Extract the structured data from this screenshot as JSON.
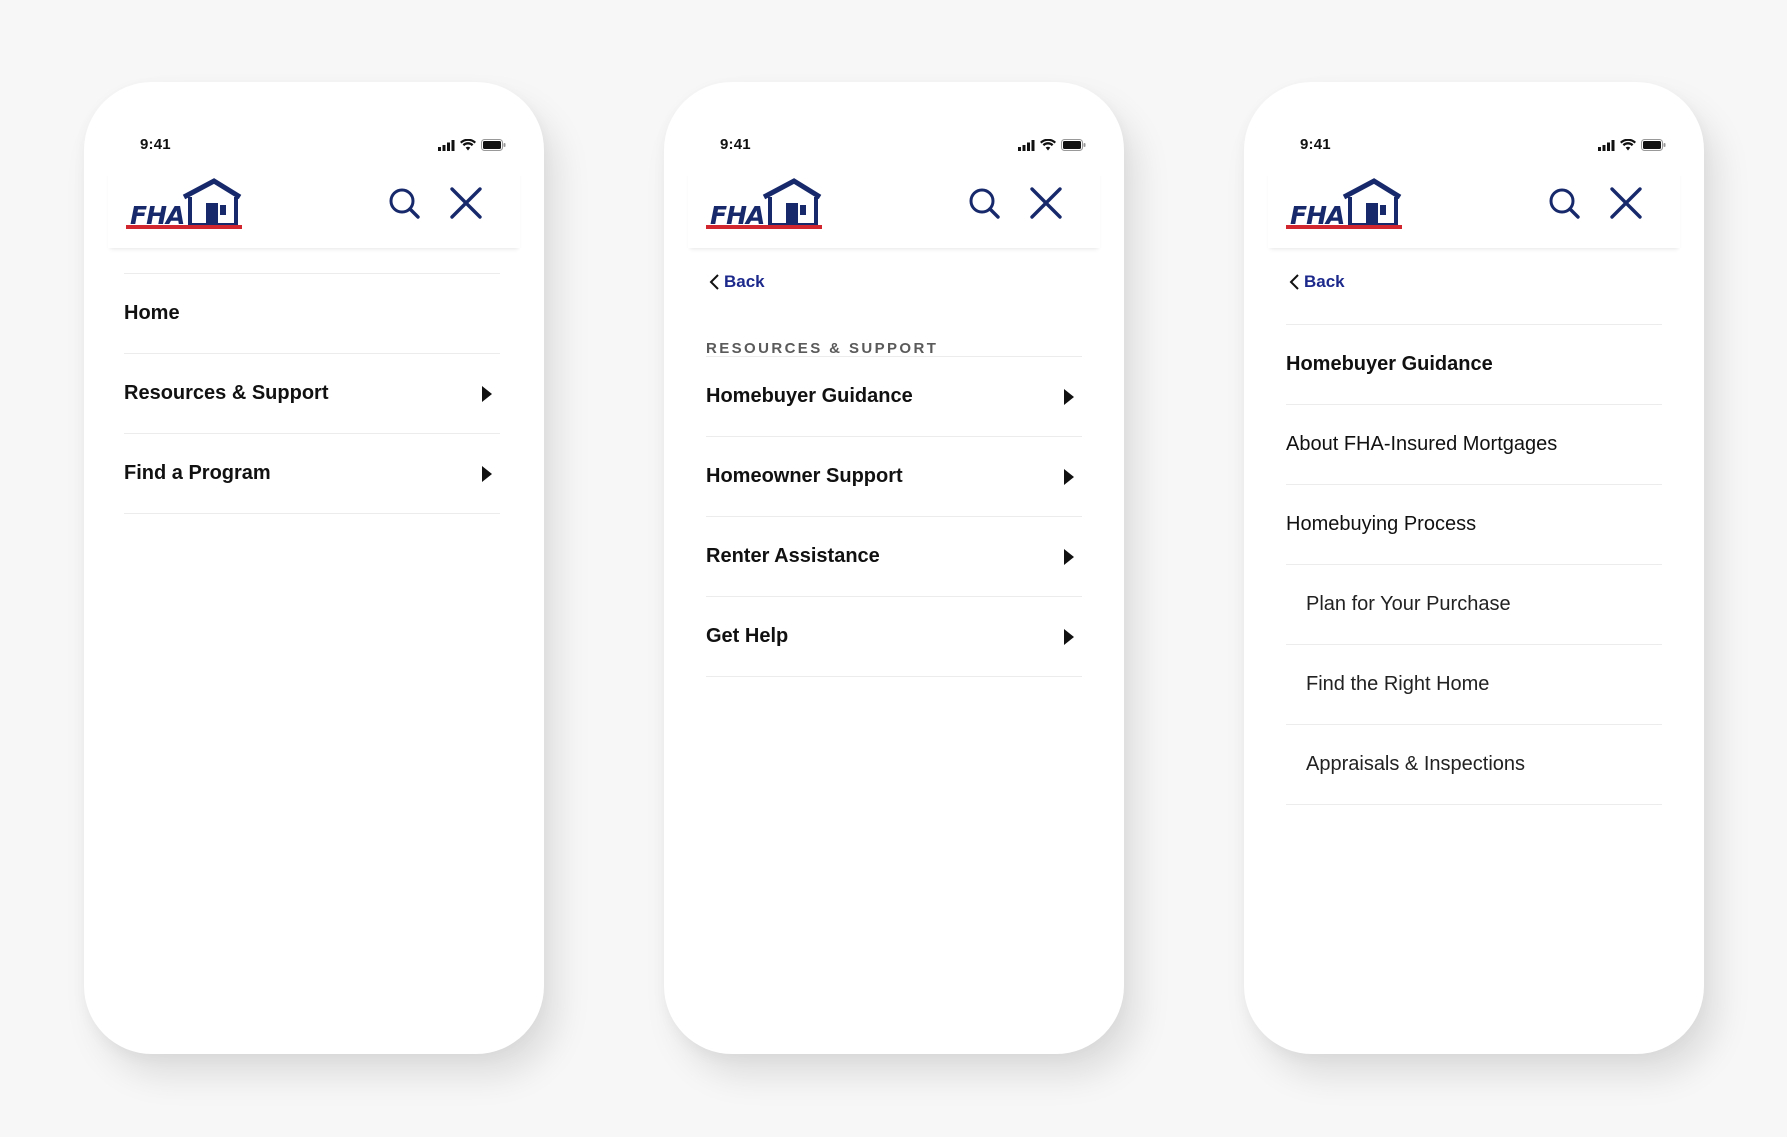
{
  "status": {
    "time": "9:41"
  },
  "logo": {
    "text": "FHA"
  },
  "brand": {
    "navy": "#17296b",
    "red": "#d2262f",
    "link": "#1d2a8c"
  },
  "header": {
    "search_icon": "search-icon",
    "close_icon": "close-icon"
  },
  "screen1": {
    "items": [
      {
        "label": "Home",
        "has_submenu": false
      },
      {
        "label": "Resources & Support",
        "has_submenu": true
      },
      {
        "label": "Find a Program",
        "has_submenu": true
      }
    ]
  },
  "screen2": {
    "back_label": "Back",
    "section_label": "RESOURCES & SUPPORT",
    "items": [
      {
        "label": "Homebuyer Guidance",
        "has_submenu": true
      },
      {
        "label": "Homeowner Support",
        "has_submenu": true
      },
      {
        "label": "Renter Assistance",
        "has_submenu": true
      },
      {
        "label": "Get Help",
        "has_submenu": true
      }
    ]
  },
  "screen3": {
    "back_label": "Back",
    "items": [
      {
        "label": "Homebuyer Guidance",
        "style": "heading"
      },
      {
        "label": "About FHA-Insured Mortgages",
        "style": "regular"
      },
      {
        "label": "Homebuying Process",
        "style": "regular"
      },
      {
        "label": "Plan for Your Purchase",
        "style": "sub"
      },
      {
        "label": "Find the Right Home",
        "style": "sub"
      },
      {
        "label": "Appraisals & Inspections",
        "style": "sub"
      }
    ]
  }
}
